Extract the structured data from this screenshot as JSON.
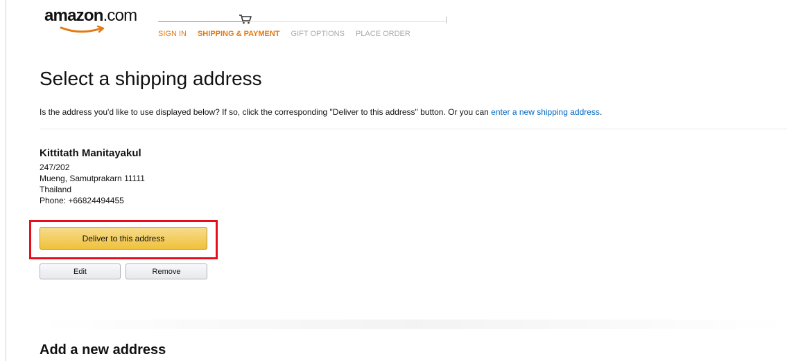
{
  "header": {
    "logo_main": "amazon",
    "logo_suffix": ".com",
    "steps": [
      {
        "label": "SIGN IN",
        "state": "done"
      },
      {
        "label": "SHIPPING & PAYMENT",
        "state": "active"
      },
      {
        "label": "GIFT OPTIONS",
        "state": "todo"
      },
      {
        "label": "PLACE ORDER",
        "state": "todo"
      }
    ],
    "progress_icon": "cart-icon"
  },
  "main": {
    "title": "Select a shipping address",
    "intro_text": "Is the address you'd like to use displayed below? If so, click the corresponding \"Deliver to this address\" button. Or you can ",
    "intro_link": "enter a new shipping address",
    "intro_end": "."
  },
  "address": {
    "name": "Kittitath Manitayakul",
    "line1": "247/202",
    "line2": "Mueng, Samutprakarn 11111",
    "country": "Thailand",
    "phone": "Phone: +66824494455",
    "deliver_label": "Deliver to this address",
    "edit_label": "Edit",
    "remove_label": "Remove"
  },
  "add_section": {
    "title": "Add a new address"
  },
  "colors": {
    "accent": "#e47911",
    "link": "#0066c0",
    "highlight": "#e3101b",
    "button_primary": "#f0c14b"
  }
}
